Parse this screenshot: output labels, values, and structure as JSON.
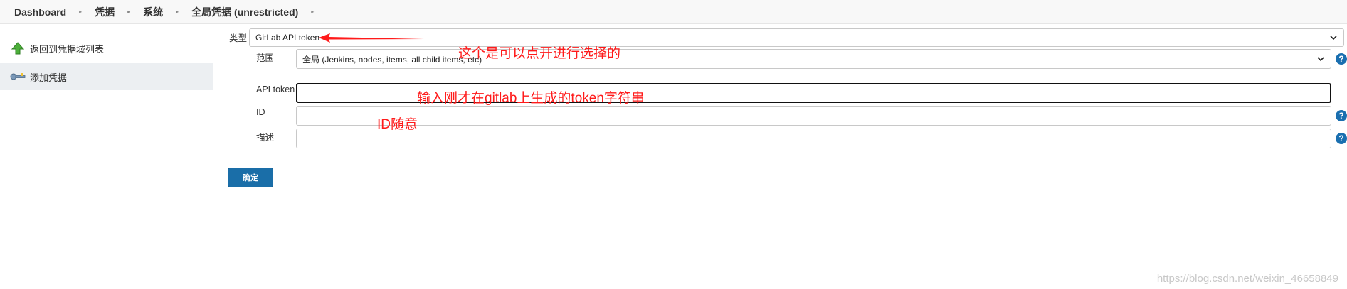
{
  "breadcrumb": [
    "Dashboard",
    "凭据",
    "系统",
    "全局凭据 (unrestricted)"
  ],
  "sidebar": {
    "items": [
      {
        "label": "返回到凭据域列表",
        "icon": "arrow-up-icon"
      },
      {
        "label": "添加凭据",
        "icon": "key-icon"
      }
    ]
  },
  "form": {
    "kind_label": "类型",
    "kind_value": "GitLab API token",
    "scope_label": "范围",
    "scope_value": "全局 (Jenkins, nodes, items, all child items, etc)",
    "token_label": "API token",
    "token_value": "",
    "id_label": "ID",
    "id_value": "",
    "desc_label": "描述",
    "desc_value": "",
    "help_glyph": "?",
    "submit_label": "确定"
  },
  "annotations": {
    "kind_note": "这个是可以点开进行选择的",
    "token_note": "输入刚才在gitlab上生成的token字符串",
    "id_note": "ID随意",
    "color": "#ff1a1a"
  },
  "watermark": "https://blog.csdn.net/weixin_46658849",
  "colors": {
    "accent": "#1a6ea8",
    "help": "#1a6fb0",
    "sidebar_active": "#eceff2"
  }
}
